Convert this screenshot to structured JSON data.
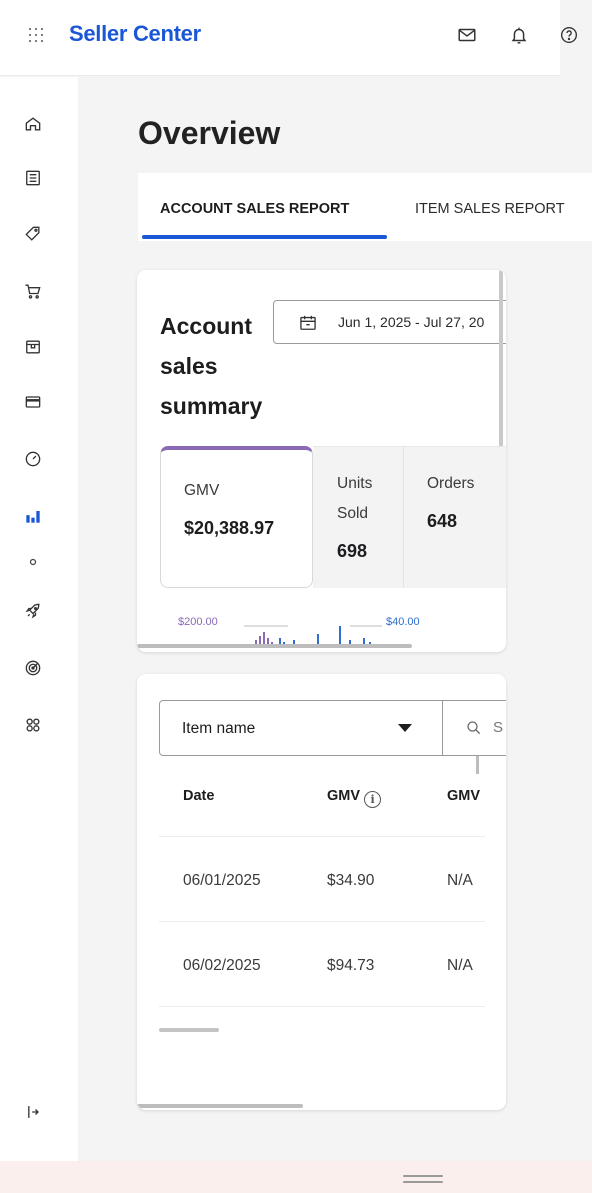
{
  "header": {
    "brand": "Seller Center",
    "icons": [
      "apps-grid-icon",
      "mail-icon",
      "bell-icon",
      "help-icon"
    ]
  },
  "sidebar": {
    "icons": [
      "home-icon",
      "orders-list-icon",
      "tag-icon",
      "cart-icon",
      "package-icon",
      "payments-card-icon",
      "performance-gauge-icon",
      "analytics-bar-chart-icon",
      "dot-icon",
      "rocket-icon",
      "target-icon",
      "apps-icon",
      "expand-sidebar-icon"
    ],
    "active": "analytics-bar-chart-icon",
    "active_color": "#1a57d6"
  },
  "page": {
    "title": "Overview",
    "tabs": [
      {
        "label": "ACCOUNT SALES REPORT",
        "active": true
      },
      {
        "label": "ITEM SALES REPORT",
        "active": false
      }
    ]
  },
  "summary": {
    "title_line1": "Account",
    "title_line2": "sales",
    "title_line3": "summary",
    "date_range": "Jun 1, 2025 - Jul 27, 20",
    "metrics": {
      "gmv_label": "GMV",
      "gmv_value": "$20,388.97",
      "units_label_1": "Units",
      "units_label_2": "Sold",
      "units_value": "698",
      "orders_label": "Orders",
      "orders_value": "648"
    },
    "mini_chart": {
      "left_label": "$200.00",
      "right_label": "$40.00",
      "left_color": "#8a6ab5",
      "right_color": "#2f6fd3"
    }
  },
  "table_card": {
    "select_value": "Item name",
    "search_placeholder": "S",
    "columns": {
      "date": "Date",
      "gmv": "GMV",
      "gmv2": "GMV"
    },
    "rows": [
      {
        "date": "06/01/2025",
        "gmv": "$34.90",
        "gmv2": "N/A"
      },
      {
        "date": "06/02/2025",
        "gmv": "$94.73",
        "gmv2": "N/A"
      }
    ]
  },
  "colors": {
    "brand_blue": "#1a57d6",
    "gmv_accent": "#8a6ab5",
    "bottom_strip": "#fbefee"
  }
}
